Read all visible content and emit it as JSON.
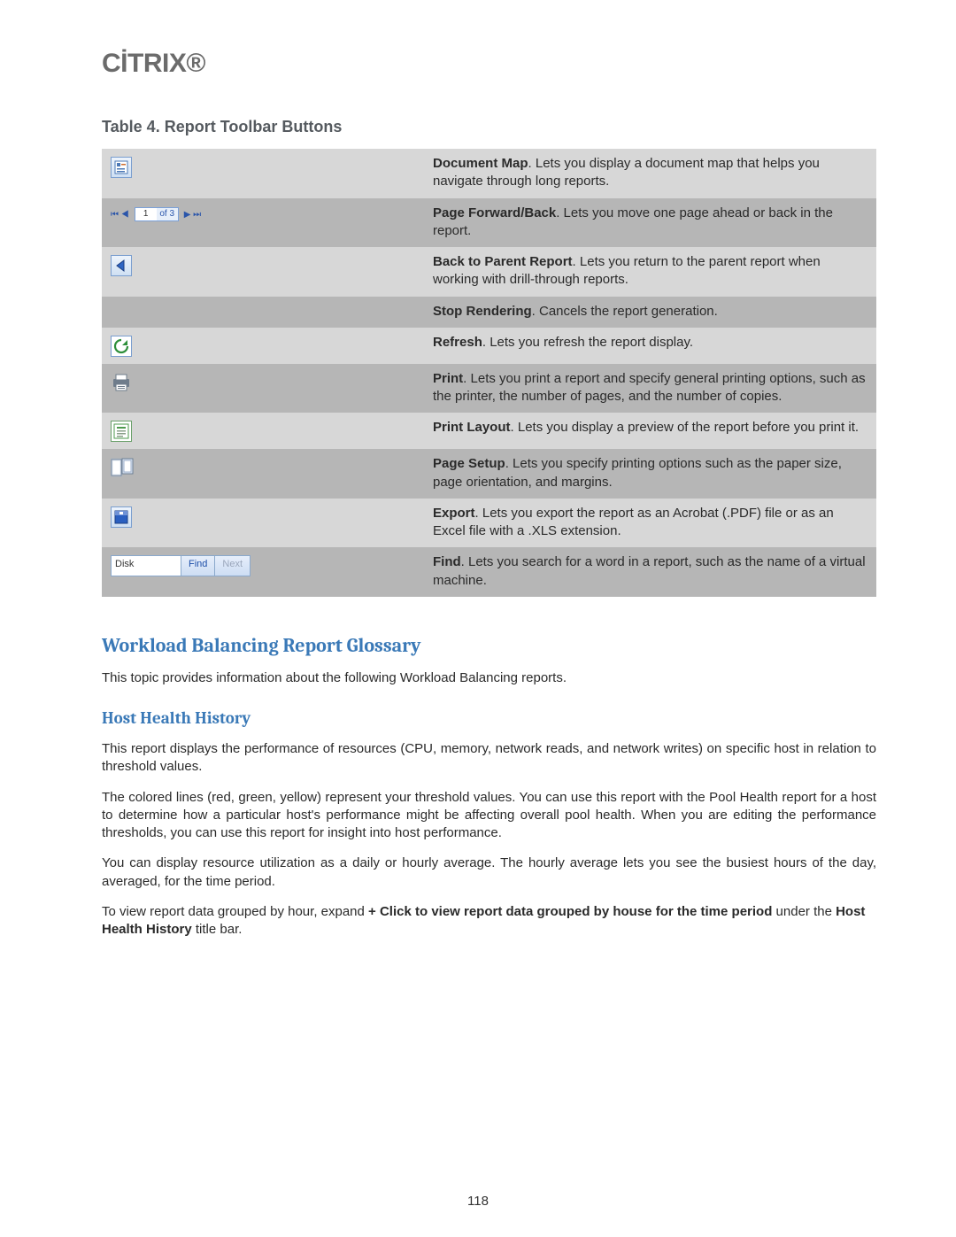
{
  "logo_text": "CİTRIX",
  "table_caption": "Table 4. Report Toolbar Buttons",
  "rows": [
    {
      "term": "Document Map",
      "desc": ". Lets you display a document map that helps you navigate through long reports."
    },
    {
      "term": "Page Forward/Back",
      "desc": ". Lets you move one page ahead or back in the report."
    },
    {
      "term": "Back to Parent Report",
      "desc": ". Lets you return to the parent report when working with drill-through reports."
    },
    {
      "term": "Stop Rendering",
      "desc": ". Cancels the report generation."
    },
    {
      "term": "Refresh",
      "desc": ". Lets you refresh the report display."
    },
    {
      "term": "Print",
      "desc": ". Lets you print a report and specify general printing options, such as the printer, the number of pages, and the number of copies."
    },
    {
      "term": "Print Layout",
      "desc": ". Lets you display a preview of the report before you print it."
    },
    {
      "term": "Page Setup",
      "desc": ". Lets you specify printing options such as the paper size, page orientation, and margins."
    },
    {
      "term": "Export",
      "desc": ". Lets you export the report as an Acrobat (.PDF) file or as an Excel file with a .XLS extension."
    },
    {
      "term": "Find",
      "desc": ". Lets you search for a word in a report, such as the name of a virtual machine."
    }
  ],
  "pager": {
    "arrows_left": "⏮ ◀",
    "page": "1",
    "of": "of 3",
    "arrows_right": "▶ ⏭"
  },
  "find": {
    "value": "Disk",
    "find_label": "Find",
    "next_label": "Next"
  },
  "h2": "Workload Balancing Report Glossary",
  "intro": "This topic provides information about the following Workload Balancing reports.",
  "h3": "Host Health History",
  "p1": "This report displays the performance of resources (CPU, memory, network reads, and network writes) on specific host in relation to threshold values.",
  "p2": "The colored lines (red, green, yellow) represent your threshold values. You can use this report with the Pool Health report for a host to determine how a particular host's performance might be affecting overall pool health. When you are editing the performance thresholds, you can use this report for insight into host performance.",
  "p3": "You can display resource utilization as a daily or hourly average. The hourly average lets you see the busiest hours of the day, averaged, for the time period.",
  "p4_a": "To view report data grouped by hour, expand ",
  "p4_bold": "+ Click to view report data grouped by house for the time period",
  "p4_b": " under the ",
  "p4_bold2": "Host Health History",
  "p4_c": " title bar.",
  "page_number": "118"
}
